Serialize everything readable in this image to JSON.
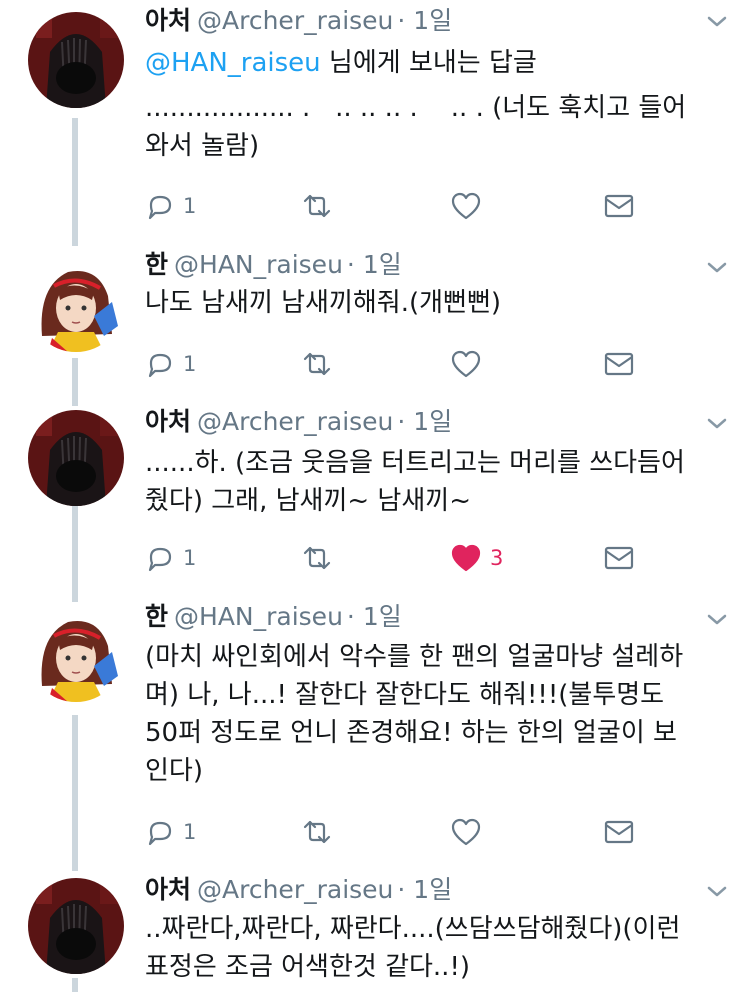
{
  "tweets": [
    {
      "name": "아처",
      "handle": "@Archer_raiseu",
      "time": "· 1일",
      "reply_prefix": "@HAN_raiseu",
      "reply_suffix": " 님에게 보내는 답글",
      "text": ".................. .   .. .. .. .    .. . (너도 훅치고 들어\n와서 놀람)",
      "replies": "1",
      "likes": "",
      "liked": false
    },
    {
      "name": "한",
      "handle": "@HAN_raiseu",
      "time": "· 1일",
      "text": "나도 남새끼 남새끼해줘.(개뻔뻔)",
      "replies": "1",
      "likes": "",
      "liked": false
    },
    {
      "name": "아처",
      "handle": "@Archer_raiseu",
      "time": "· 1일",
      "text": "......하. (조금 웃음을 터트리고는 머리를 쓰다듬어\n줬다) 그래, 남새끼~ 남새끼~",
      "replies": "1",
      "likes": "3",
      "liked": true
    },
    {
      "name": "한",
      "handle": "@HAN_raiseu",
      "time": "· 1일",
      "text": "(마치 싸인회에서 악수를 한 팬의 얼굴마냥 설레하\n며) 나, 나...! 잘한다 잘한다도 해줘!!!(불투명도\n50퍼 정도로 언니 존경해요! 하는 한의 얼굴이 보\n인다)",
      "replies": "1",
      "likes": "",
      "liked": false
    },
    {
      "name": "아처",
      "handle": "@Archer_raiseu",
      "time": "· 1일",
      "text": "..짜란다,짜란다, 짜란다....(쓰담쓰담해줬다)(이런\n표정은 조금 어색한것 같다..!)",
      "replies": "",
      "likes": "",
      "liked": false
    }
  ],
  "icons": {
    "reply": "reply-icon",
    "retweet": "retweet-icon",
    "like": "heart-icon",
    "dm": "envelope-icon",
    "more": "chevron-down-icon"
  },
  "colors": {
    "link": "#1da1f2",
    "secondary": "#657786",
    "like": "#e0245e",
    "thread_line": "#ccd6dd"
  }
}
